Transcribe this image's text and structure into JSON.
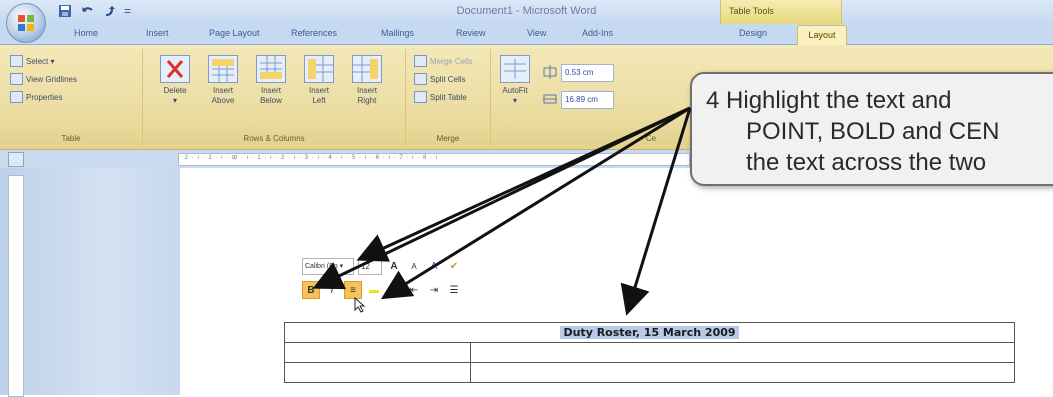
{
  "titlebar": {
    "document_title": "Document1 - Microsoft Word",
    "context_label": "Table Tools",
    "qat_separator": "="
  },
  "tabs": [
    "Home",
    "Insert",
    "Page Layout",
    "References",
    "Mailings",
    "Review",
    "View",
    "Add-Ins",
    "Design",
    "Layout"
  ],
  "active_tab": "Layout",
  "ribbon": {
    "table_group": {
      "label": "Table",
      "items": [
        "Select ▾",
        "View Gridlines",
        "Properties"
      ]
    },
    "rows_columns_group": {
      "label": "Rows & Columns",
      "buttons": [
        {
          "l1": "Delete",
          "l2": "▾"
        },
        {
          "l1": "Insert",
          "l2": "Above"
        },
        {
          "l1": "Insert",
          "l2": "Below"
        },
        {
          "l1": "Insert",
          "l2": "Left"
        },
        {
          "l1": "Insert",
          "l2": "Right"
        }
      ]
    },
    "merge_group": {
      "label": "Merge",
      "items": [
        "Merge Cells",
        "Split Cells",
        "Split Table"
      ]
    },
    "autofit": {
      "l1": "AutoFit",
      "l2": "▾"
    },
    "cell_size": {
      "height": "0.53 cm",
      "width": "16.89 cm",
      "label": "Ce"
    }
  },
  "ruler": {
    "text": "· 2 · ı · 1 · ı · ⊞ · ı · 1 · ı · 2 · ı · 3 · ı · 4 · ı · 5 · ı · 6 · ı · 7 · ı · 8 · ı"
  },
  "mini_toolbar": {
    "font": "Calibri (Bo ▾",
    "size": "12",
    "grow": "A",
    "shrink": "A",
    "styles": "A",
    "painter": "✔",
    "bold": "B",
    "italic": "I",
    "center": "≡",
    "highlight": "▬",
    "font_color": "A",
    "indent_dec": "⇤",
    "indent_inc": "⇥",
    "bullets": "☰"
  },
  "table": {
    "title": "Duty Roster, 15 March 2009",
    "rows": [
      [
        "",
        ""
      ],
      [
        "",
        ""
      ]
    ]
  },
  "callout": {
    "number": "4",
    "line1": "Highlight the text and",
    "line2": "POINT, BOLD and CEN",
    "line3": "the text across the two"
  },
  "colors": {
    "accent": "#f7c25b",
    "ribbon": "#eadca0",
    "selection": "#b8c9e9"
  }
}
